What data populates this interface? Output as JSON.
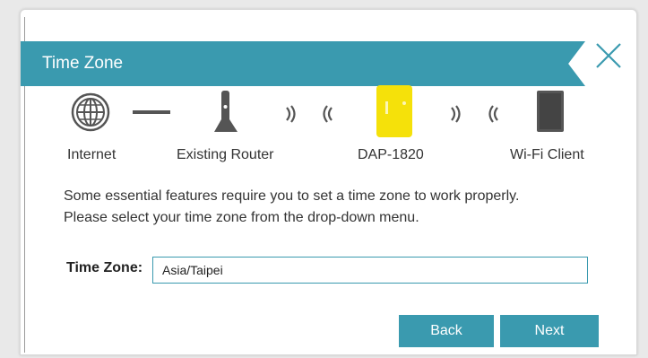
{
  "dialog": {
    "title": "Time Zone",
    "close_icon": "close-icon"
  },
  "topology": {
    "items": [
      {
        "label": "Internet",
        "icon": "globe-icon"
      },
      {
        "label": "Existing Router",
        "icon": "router-icon"
      },
      {
        "label": "DAP-1820",
        "icon": "extender-device-icon"
      },
      {
        "label": "Wi-Fi Client",
        "icon": "tablet-icon"
      }
    ]
  },
  "description": {
    "line1": "Some essential features require you to set a time zone to work properly.",
    "line2": "Please select your time zone from the drop-down menu."
  },
  "time_zone": {
    "label": "Time Zone:",
    "value": "Asia/Taipei"
  },
  "buttons": {
    "back_label": "Back",
    "next_label": "Next"
  },
  "colors": {
    "accent": "#3a9aaf",
    "device": "#f5e10a",
    "icon": "#555555"
  }
}
